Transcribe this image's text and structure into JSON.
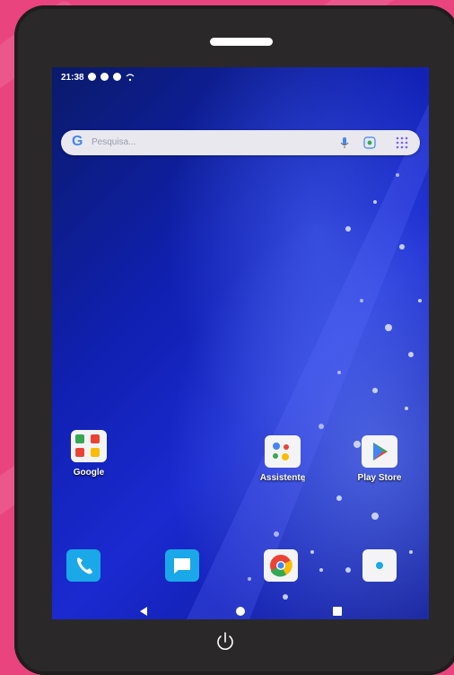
{
  "colors": {
    "background": "#e9447e",
    "bezel": "#2a2828",
    "screen_blue": "#1a2ad0"
  },
  "status_bar": {
    "time": "21:38",
    "icons": [
      "shield-icon",
      "gear-icon",
      "info-icon",
      "wifi-icon"
    ]
  },
  "search": {
    "logo": "G",
    "placeholder": "Pesquisa..."
  },
  "home_apps": [
    {
      "label": "Google",
      "icon": "google-folder-icon"
    },
    {
      "label": "Assistente",
      "icon": "assistant-icon"
    },
    {
      "label": "Play Store",
      "icon": "play-store-icon"
    }
  ],
  "dock": [
    {
      "icon": "phone-icon",
      "color": "#1aa8e8"
    },
    {
      "icon": "messages-icon",
      "color": "#1aa8e8"
    },
    {
      "icon": "chrome-icon",
      "color": "#f4f4f6"
    },
    {
      "icon": "camera-icon",
      "color": "#f4f4f6"
    }
  ],
  "nav_bar": [
    "back-icon",
    "home-icon",
    "recents-icon"
  ]
}
